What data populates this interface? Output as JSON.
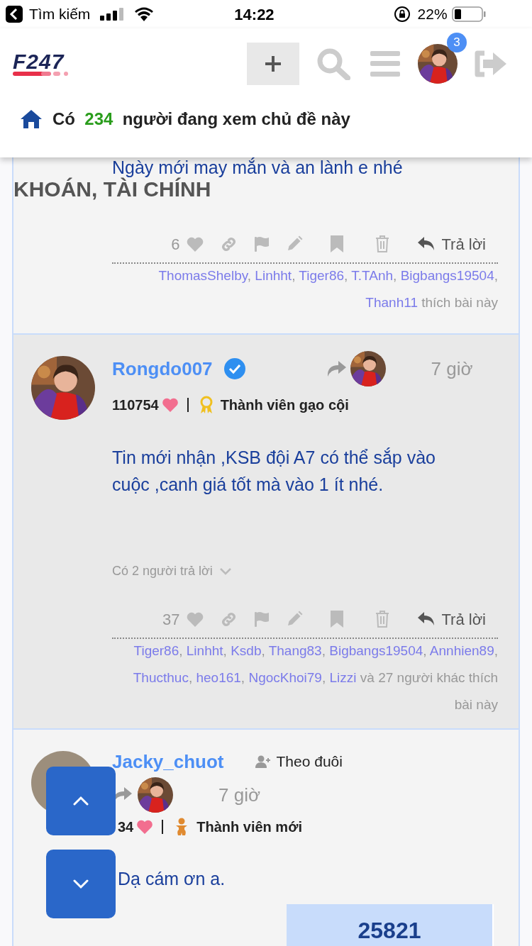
{
  "status_bar": {
    "back_label": "Tìm kiếm",
    "time": "14:22",
    "battery": "22%"
  },
  "header": {
    "logo_text": "F247",
    "notification_count": "3",
    "viewers": {
      "prefix": "Có",
      "count": "234",
      "suffix": "người đang xem chủ đề này"
    }
  },
  "posts": [
    {
      "kind": "partial",
      "body": "Ngày mới may mắn và an lành e nhé",
      "heading": "KHOÁN, TÀI CHÍNH",
      "like_count": "6",
      "reply_label": "Trả lời",
      "likers": [
        "ThomasShelby",
        "Linhht",
        "Tiger86",
        "T.TAnh",
        "Bigbangs19504",
        "Thanh11"
      ],
      "separator": ",",
      "likes_suffix": "thích bài này"
    },
    {
      "kind": "full",
      "username": "Rongdo007",
      "verified": true,
      "time": "7 giờ",
      "score": "110754",
      "rank": {
        "kind": "veteran",
        "label": "Thành viên gạo cội"
      },
      "body": "Tin mới nhận ,KSB đội A7 có thể sắp vào cuộc ,canh giá tốt mà vào 1 ít nhé.",
      "replies_label": "Có 2 người trả lời",
      "like_count": "37",
      "reply_label": "Trả lời",
      "likers": [
        "Tiger86",
        "Linhht",
        "Ksdb",
        "Thang83",
        "Bigbangs19504",
        "Annhien89",
        "Thucthuc",
        "heo161",
        "NgocKhoi79",
        "Lizzi"
      ],
      "separator": ",",
      "likes_suffix": "và 27 người khác thích bài này"
    },
    {
      "kind": "new",
      "username": "Jacky_chuot",
      "verified": false,
      "follow_label": "Theo đuôi",
      "time": "7 giờ",
      "score": "34",
      "rank": {
        "kind": "newbie",
        "label": "Thành viên mới"
      },
      "body": "Dạ cám ơn a.",
      "counter": "25821"
    }
  ],
  "scroll_buttons": [
    {
      "kind": "up"
    },
    {
      "kind": "down"
    }
  ]
}
